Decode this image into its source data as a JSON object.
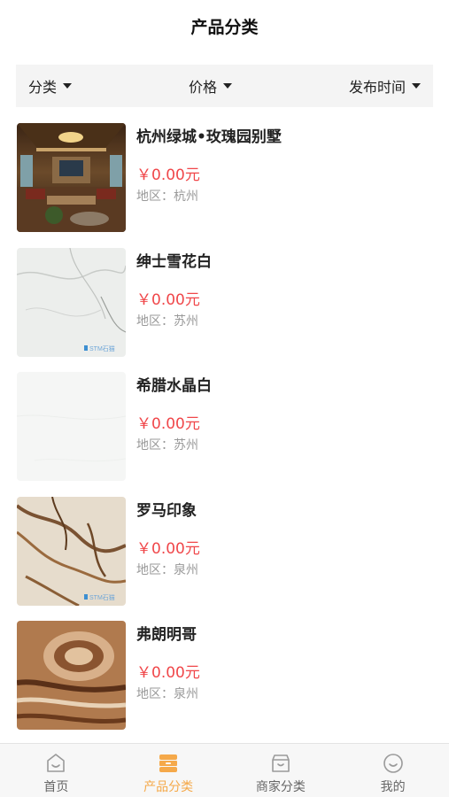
{
  "header": {
    "title": "产品分类"
  },
  "filters": [
    {
      "label": "分类",
      "icon": "caret-down-icon"
    },
    {
      "label": "价格",
      "icon": "caret-down-icon"
    },
    {
      "label": "发布时间",
      "icon": "caret-down-icon"
    }
  ],
  "products": [
    {
      "name": "杭州绿城•玫瑰园别墅",
      "price": "￥0.00元",
      "region": "地区：杭州",
      "thumb": "villa-interior-photo"
    },
    {
      "name": "绅士雪花白",
      "price": "￥0.00元",
      "region": "地区：苏州",
      "thumb": "white-marble-photo"
    },
    {
      "name": "希腊水晶白",
      "price": "￥0.00元",
      "region": "地区：苏州",
      "thumb": "crystal-white-marble-photo"
    },
    {
      "name": "罗马印象",
      "price": "￥0.00元",
      "region": "地区：泉州",
      "thumb": "roman-impression-marble-photo"
    },
    {
      "name": "弗朗明哥",
      "price": "￥0.00元",
      "region": "地区：泉州",
      "thumb": "flamenco-marble-photo"
    }
  ],
  "watermark": "STM石猫",
  "tabbar": [
    {
      "label": "首页",
      "icon": "home-icon",
      "active": false
    },
    {
      "label": "产品分类",
      "icon": "category-icon",
      "active": true
    },
    {
      "label": "商家分类",
      "icon": "shop-icon",
      "active": false
    },
    {
      "label": "我的",
      "icon": "profile-icon",
      "active": false
    }
  ],
  "colors": {
    "price": "#f0474a",
    "tab_active": "#f5a94a",
    "tab_inactive": "#666666",
    "filter_bg": "#f4f4f4"
  }
}
